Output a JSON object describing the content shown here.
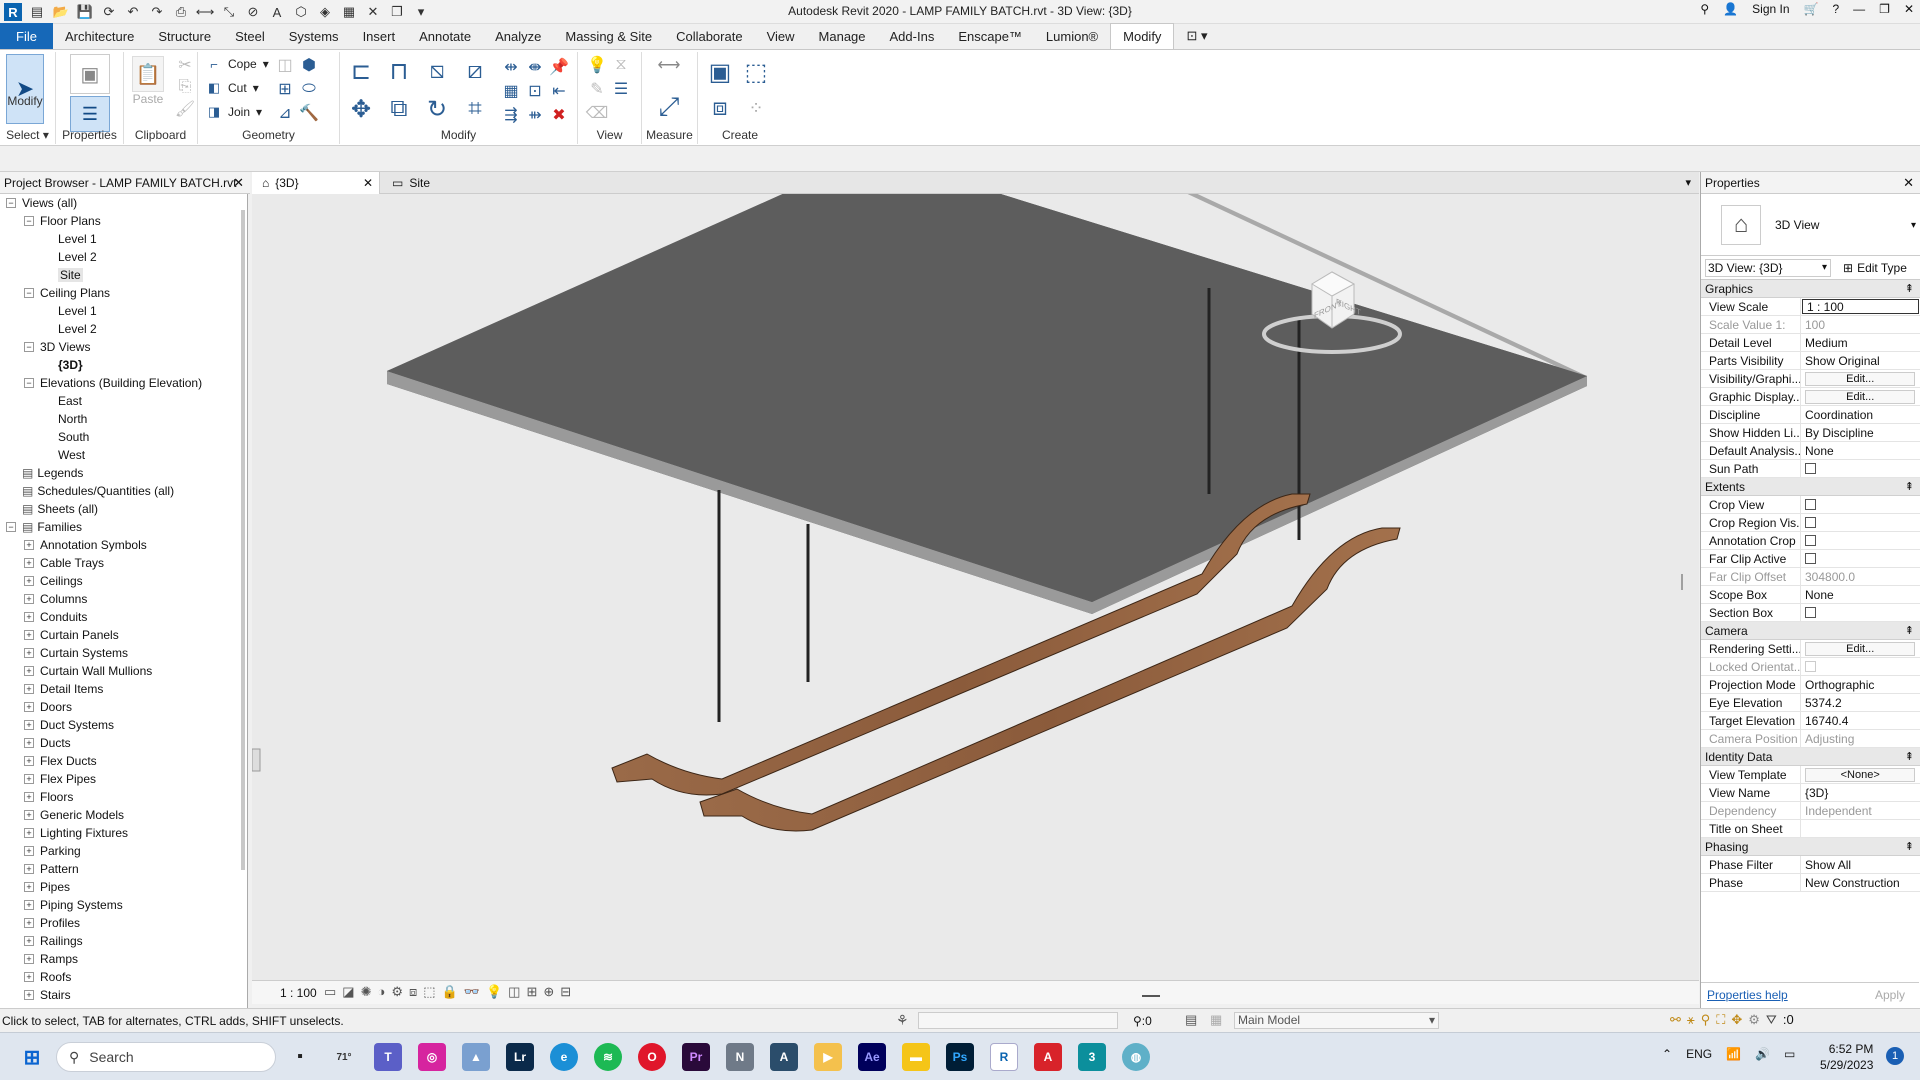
{
  "window": {
    "title": "Autodesk Revit 2020 - LAMP FAMILY BATCH.rvt - 3D View: {3D}",
    "sign_in": "Sign In"
  },
  "menu": [
    "File",
    "Architecture",
    "Structure",
    "Steel",
    "Systems",
    "Insert",
    "Annotate",
    "Analyze",
    "Massing & Site",
    "Collaborate",
    "View",
    "Manage",
    "Add-Ins",
    "Enscape™",
    "Lumion®",
    "Modify"
  ],
  "ribbon": {
    "select": {
      "button": "Modify",
      "label": "Select"
    },
    "properties": {
      "button": "Properties"
    },
    "clipboard": {
      "paste": "Paste",
      "label": "Clipboard"
    },
    "geometry": {
      "cope": "Cope",
      "cut": "Cut",
      "join": "Join",
      "label": "Geometry"
    },
    "modify": {
      "label": "Modify"
    },
    "view": {
      "label": "View"
    },
    "measure": {
      "label": "Measure"
    },
    "create": {
      "label": "Create"
    }
  },
  "project_browser": {
    "title": "Project Browser - LAMP FAMILY BATCH.rvt",
    "items": [
      {
        "label": "Views (all)",
        "level": 0,
        "exp": "-"
      },
      {
        "label": "Floor Plans",
        "level": 1,
        "exp": "-"
      },
      {
        "label": "Level 1",
        "level": 2
      },
      {
        "label": "Level 2",
        "level": 2
      },
      {
        "label": "Site",
        "level": 2,
        "sel": true
      },
      {
        "label": "Ceiling Plans",
        "level": 1,
        "exp": "-"
      },
      {
        "label": "Level 1",
        "level": 2
      },
      {
        "label": "Level 2",
        "level": 2
      },
      {
        "label": "3D Views",
        "level": 1,
        "exp": "-"
      },
      {
        "label": "{3D}",
        "level": 2,
        "bold": true
      },
      {
        "label": "Elevations (Building Elevation)",
        "level": 1,
        "exp": "-"
      },
      {
        "label": "East",
        "level": 2
      },
      {
        "label": "North",
        "level": 2
      },
      {
        "label": "South",
        "level": 2
      },
      {
        "label": "West",
        "level": 2
      },
      {
        "label": "Legends",
        "level": 0,
        "icon": true
      },
      {
        "label": "Schedules/Quantities (all)",
        "level": 0,
        "icon": true
      },
      {
        "label": "Sheets (all)",
        "level": 0,
        "icon": true
      },
      {
        "label": "Families",
        "level": 0,
        "exp": "-",
        "icon": true
      },
      {
        "label": "Annotation Symbols",
        "level": 1,
        "exp": "+"
      },
      {
        "label": "Cable Trays",
        "level": 1,
        "exp": "+"
      },
      {
        "label": "Ceilings",
        "level": 1,
        "exp": "+"
      },
      {
        "label": "Columns",
        "level": 1,
        "exp": "+"
      },
      {
        "label": "Conduits",
        "level": 1,
        "exp": "+"
      },
      {
        "label": "Curtain Panels",
        "level": 1,
        "exp": "+"
      },
      {
        "label": "Curtain Systems",
        "level": 1,
        "exp": "+"
      },
      {
        "label": "Curtain Wall Mullions",
        "level": 1,
        "exp": "+"
      },
      {
        "label": "Detail Items",
        "level": 1,
        "exp": "+"
      },
      {
        "label": "Doors",
        "level": 1,
        "exp": "+"
      },
      {
        "label": "Duct Systems",
        "level": 1,
        "exp": "+"
      },
      {
        "label": "Ducts",
        "level": 1,
        "exp": "+"
      },
      {
        "label": "Flex Ducts",
        "level": 1,
        "exp": "+"
      },
      {
        "label": "Flex Pipes",
        "level": 1,
        "exp": "+"
      },
      {
        "label": "Floors",
        "level": 1,
        "exp": "+"
      },
      {
        "label": "Generic Models",
        "level": 1,
        "exp": "+"
      },
      {
        "label": "Lighting Fixtures",
        "level": 1,
        "exp": "+"
      },
      {
        "label": "Parking",
        "level": 1,
        "exp": "+"
      },
      {
        "label": "Pattern",
        "level": 1,
        "exp": "+"
      },
      {
        "label": "Pipes",
        "level": 1,
        "exp": "+"
      },
      {
        "label": "Piping Systems",
        "level": 1,
        "exp": "+"
      },
      {
        "label": "Profiles",
        "level": 1,
        "exp": "+"
      },
      {
        "label": "Railings",
        "level": 1,
        "exp": "+"
      },
      {
        "label": "Ramps",
        "level": 1,
        "exp": "+"
      },
      {
        "label": "Roofs",
        "level": 1,
        "exp": "+"
      },
      {
        "label": "Stairs",
        "level": 1,
        "exp": "+"
      }
    ]
  },
  "view_tabs": [
    {
      "label": "{3D}"
    },
    {
      "label": "Site"
    }
  ],
  "view_cube": {
    "front": "FRONT",
    "right": "RIGHT"
  },
  "view_bar": {
    "scale": "1 : 100"
  },
  "properties": {
    "title": "Properties",
    "type_name": "3D View",
    "instance": "3D View: {3D}",
    "edit_type": "Edit Type",
    "sections": [
      {
        "name": "Graphics",
        "rows": [
          {
            "k": "View Scale",
            "v": "1 : 100",
            "box": true
          },
          {
            "k": "Scale Value    1:",
            "v": "100",
            "gray": true
          },
          {
            "k": "Detail Level",
            "v": "Medium"
          },
          {
            "k": "Parts Visibility",
            "v": "Show Original"
          },
          {
            "k": "Visibility/Graphi...",
            "v": "Edit...",
            "btn": true
          },
          {
            "k": "Graphic Display...",
            "v": "Edit...",
            "btn": true
          },
          {
            "k": "Discipline",
            "v": "Coordination"
          },
          {
            "k": "Show Hidden Li...",
            "v": "By Discipline"
          },
          {
            "k": "Default Analysis...",
            "v": "None"
          },
          {
            "k": "Sun Path",
            "v": "",
            "chk": true
          }
        ]
      },
      {
        "name": "Extents",
        "rows": [
          {
            "k": "Crop View",
            "v": "",
            "chk": true
          },
          {
            "k": "Crop Region Vis...",
            "v": "",
            "chk": true
          },
          {
            "k": "Annotation Crop",
            "v": "",
            "chk": true
          },
          {
            "k": "Far Clip Active",
            "v": "",
            "chk": true
          },
          {
            "k": "Far Clip Offset",
            "v": "304800.0",
            "gray": true
          },
          {
            "k": "Scope Box",
            "v": "None"
          },
          {
            "k": "Section Box",
            "v": "",
            "chk": true
          }
        ]
      },
      {
        "name": "Camera",
        "rows": [
          {
            "k": "Rendering Setti...",
            "v": "Edit...",
            "btn": true
          },
          {
            "k": "Locked Orientat...",
            "v": "",
            "chk": true,
            "gray": true
          },
          {
            "k": "Projection Mode",
            "v": "Orthographic"
          },
          {
            "k": "Eye Elevation",
            "v": "5374.2"
          },
          {
            "k": "Target Elevation",
            "v": "16740.4"
          },
          {
            "k": "Camera Position",
            "v": "Adjusting",
            "gray": true
          }
        ]
      },
      {
        "name": "Identity Data",
        "rows": [
          {
            "k": "View Template",
            "v": "<None>",
            "btn": true
          },
          {
            "k": "View Name",
            "v": "{3D}"
          },
          {
            "k": "Dependency",
            "v": "Independent",
            "gray": true
          },
          {
            "k": "Title on Sheet",
            "v": ""
          }
        ]
      },
      {
        "name": "Phasing",
        "rows": [
          {
            "k": "Phase Filter",
            "v": "Show All"
          },
          {
            "k": "Phase",
            "v": "New Construction"
          }
        ]
      }
    ],
    "help": "Properties help",
    "apply": "Apply"
  },
  "status": {
    "hint": "Click to select, TAB for alternates, CTRL adds, SHIFT unselects.",
    "count": ":0",
    "workset": "Main Model",
    "filter": ":0"
  },
  "taskbar": {
    "search": "Search",
    "weather": "71°",
    "lang": "ENG",
    "time": "6:52 PM",
    "date": "5/29/2023",
    "badge": "1"
  },
  "colors": {
    "file_tab": "#1668b8",
    "wood": "#8a5a3a",
    "slab": "#5a5a5a"
  }
}
